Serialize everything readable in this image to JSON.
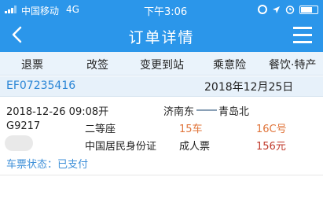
{
  "status_bar": {
    "carrier": "中国移动",
    "network": "4G",
    "time": "下午3:06"
  },
  "nav": {
    "title": "订单详情",
    "back_icon": "chevron-left-icon",
    "menu_icon": "hamburger-menu-icon"
  },
  "actions": [
    "退票",
    "改签",
    "变更到站",
    "乘意险",
    "餐饮·特产"
  ],
  "order": {
    "number": "EF07235416",
    "date": "2018年12月25日"
  },
  "ticket": {
    "departure": "2018-12-26  09:08开",
    "from_station": "济南东",
    "to_station": "青岛北",
    "train_no": "G9217",
    "seat_class": "二等座",
    "car": "15车",
    "seat": "16C号",
    "id_type": "中国居民身份证",
    "ticket_type": "成人票",
    "price": "156元",
    "status": "车票状态：已支付"
  },
  "colors": {
    "brand": "#2b96ea",
    "accent_orange": "#e0743a",
    "price_red": "#c0392b",
    "link_blue": "#2b86d6"
  }
}
